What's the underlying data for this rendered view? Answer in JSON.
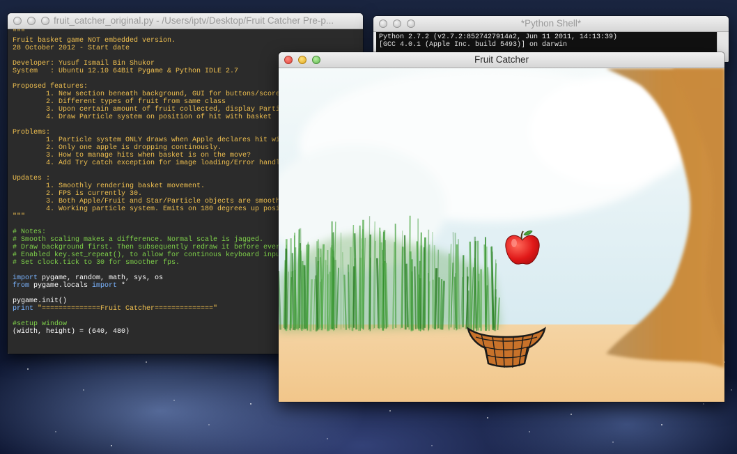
{
  "editor": {
    "title": "fruit_catcher_original.py - /Users/iptv/Desktop/Fruit Catcher Pre-p...",
    "lines": [
      {
        "t": "\"\"\"",
        "c": "c-doc"
      },
      {
        "t": "Fruit basket game NOT embedded version.",
        "c": "c-doc"
      },
      {
        "t": "28 October 2012 - Start date",
        "c": "c-doc"
      },
      {
        "t": "",
        "c": "c-doc"
      },
      {
        "t": "Developer: Yusuf Ismail Bin Shukor",
        "c": "c-doc"
      },
      {
        "t": "System   : Ubuntu 12.10 64Bit Pygame & Python IDLE 2.7",
        "c": "c-doc"
      },
      {
        "t": "",
        "c": "c-doc"
      },
      {
        "t": "Proposed features:",
        "c": "c-doc"
      },
      {
        "t": "        1. New section beneath background, GUI for buttons/score",
        "c": "c-doc"
      },
      {
        "t": "        2. Different types of fruit from same class",
        "c": "c-doc"
      },
      {
        "t": "        3. Upon certain amount of fruit collected, display Parti",
        "c": "c-doc"
      },
      {
        "t": "        4. Draw Particle system on position of hit with basket",
        "c": "c-doc"
      },
      {
        "t": "",
        "c": "c-doc"
      },
      {
        "t": "Problems:",
        "c": "c-doc"
      },
      {
        "t": "        1. Particle system ONLY draws when Apple declares hit wi",
        "c": "c-doc"
      },
      {
        "t": "        2. Only one apple is dropping continously.",
        "c": "c-doc"
      },
      {
        "t": "        3. How to manage hits when basket is on the move?",
        "c": "c-doc"
      },
      {
        "t": "        4. Add Try catch exception for image loading/Error handl",
        "c": "c-doc"
      },
      {
        "t": "",
        "c": "c-doc"
      },
      {
        "t": "Updates :",
        "c": "c-doc"
      },
      {
        "t": "        1. Smoothly rendering basket movement.",
        "c": "c-doc"
      },
      {
        "t": "        2. FPS is currently 30.",
        "c": "c-doc"
      },
      {
        "t": "        3. Both Apple/Fruit and Star/Particle objects are smooth",
        "c": "c-doc"
      },
      {
        "t": "        4. Working particle system. Emits on 180 degrees up posi",
        "c": "c-doc"
      },
      {
        "t": "\"\"\"",
        "c": "c-doc"
      },
      {
        "t": "",
        "c": "c-doc"
      },
      {
        "t": "# Notes:",
        "c": "c-cmt"
      },
      {
        "t": "# Smooth scaling makes a difference. Normal scale is jagged.",
        "c": "c-cmt"
      },
      {
        "t": "# Draw background first. Then subsequently redraw it before ever",
        "c": "c-cmt"
      },
      {
        "t": "# Enabled key.set_repeat(), to allow for continous keyboard inpu",
        "c": "c-cmt"
      },
      {
        "t": "# Set clock.tick to 30 for smoother fps.",
        "c": "c-cmt"
      },
      {
        "t": "",
        "c": "c-doc"
      },
      {
        "parts": [
          {
            "t": "import",
            "c": "c-kw"
          },
          {
            "t": " pygame, random, math, sys, os",
            "c": "c-txt"
          }
        ]
      },
      {
        "parts": [
          {
            "t": "from",
            "c": "c-kw"
          },
          {
            "t": " pygame.locals ",
            "c": "c-txt"
          },
          {
            "t": "import",
            "c": "c-kw"
          },
          {
            "t": " *",
            "c": "c-txt"
          }
        ]
      },
      {
        "t": "",
        "c": "c-doc"
      },
      {
        "t": "pygame.init()",
        "c": "c-txt"
      },
      {
        "parts": [
          {
            "t": "print",
            "c": "c-kw"
          },
          {
            "t": " \"==============Fruit Catcher==============\"",
            "c": "c-str"
          }
        ]
      },
      {
        "t": "",
        "c": "c-doc"
      },
      {
        "t": "#setup window",
        "c": "c-cmt"
      },
      {
        "t": "(width, height) = (640, 480)",
        "c": "c-txt"
      }
    ]
  },
  "shell": {
    "title": "*Python Shell*",
    "lines": [
      "Python 2.7.2 (v2.7.2:8527427914a2, Jun 11 2011, 14:13:39)",
      "[GCC 4.0.1 (Apple Inc. build 5493)] on darwin"
    ]
  },
  "game": {
    "title": "Fruit Catcher"
  },
  "colors": {
    "editor_bg": "#2b2b2b",
    "docstring": "#f0c050",
    "comment": "#7fd14a",
    "keyword": "#7ab4ff",
    "apple": "#e41b1b",
    "basket": "#c8722a",
    "ground": "#f3cc96",
    "tree": "#c98a3c"
  }
}
